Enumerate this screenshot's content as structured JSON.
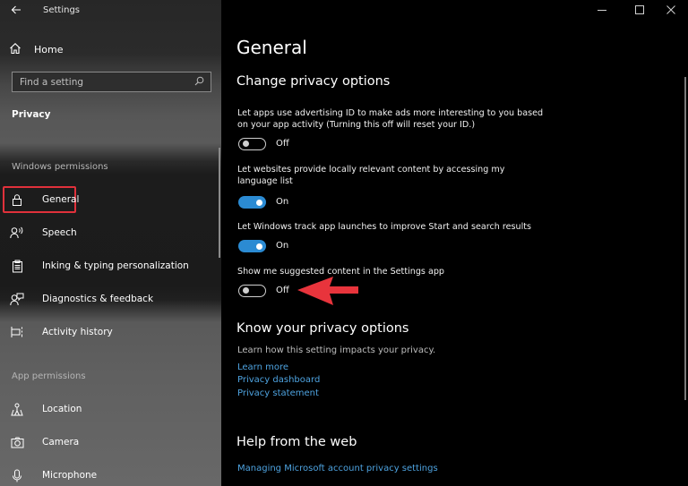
{
  "window": {
    "title": "Settings",
    "back_icon": "back-arrow-icon",
    "controls": {
      "minimize": "minimize-icon",
      "maximize": "maximize-icon",
      "close": "close-icon"
    }
  },
  "sidebar": {
    "home_label": "Home",
    "search_placeholder": "Find a setting",
    "breadcrumb": "Privacy",
    "windows_permissions_label": "Windows permissions",
    "windows_items": [
      {
        "label": "General",
        "icon": "lock-icon",
        "selected": true
      },
      {
        "label": "Speech",
        "icon": "speech-icon"
      },
      {
        "label": "Inking & typing personalization",
        "icon": "clipboard-icon"
      },
      {
        "label": "Diagnostics & feedback",
        "icon": "feedback-icon"
      },
      {
        "label": "Activity history",
        "icon": "timeline-icon"
      }
    ],
    "app_permissions_label": "App permissions",
    "app_items": [
      {
        "label": "Location",
        "icon": "location-icon"
      },
      {
        "label": "Camera",
        "icon": "camera-icon"
      },
      {
        "label": "Microphone",
        "icon": "microphone-icon"
      }
    ]
  },
  "main": {
    "title": "General",
    "change_section": "Change privacy options",
    "options": [
      {
        "label": "Let apps use advertising ID to make ads more interesting to you based on your app activity (Turning this off will reset your ID.)",
        "state": "Off",
        "on": false
      },
      {
        "label": "Let websites provide locally relevant content by accessing my language list",
        "state": "On",
        "on": true
      },
      {
        "label": "Let Windows track app launches to improve Start and search results",
        "state": "On",
        "on": true
      },
      {
        "label": "Show me suggested content in the Settings app",
        "state": "Off",
        "on": false
      }
    ],
    "know_section": "Know your privacy options",
    "know_desc": "Learn how this setting impacts your privacy.",
    "know_links": [
      "Learn more",
      "Privacy dashboard",
      "Privacy statement"
    ],
    "help_section": "Help from the web",
    "help_links": [
      "Managing Microsoft account privacy settings"
    ]
  },
  "annotation": {
    "color": "#e8343c",
    "highlight_color": "#e0313b"
  },
  "colors": {
    "accent": "#2b8bd3",
    "link": "#4ea3e0"
  }
}
